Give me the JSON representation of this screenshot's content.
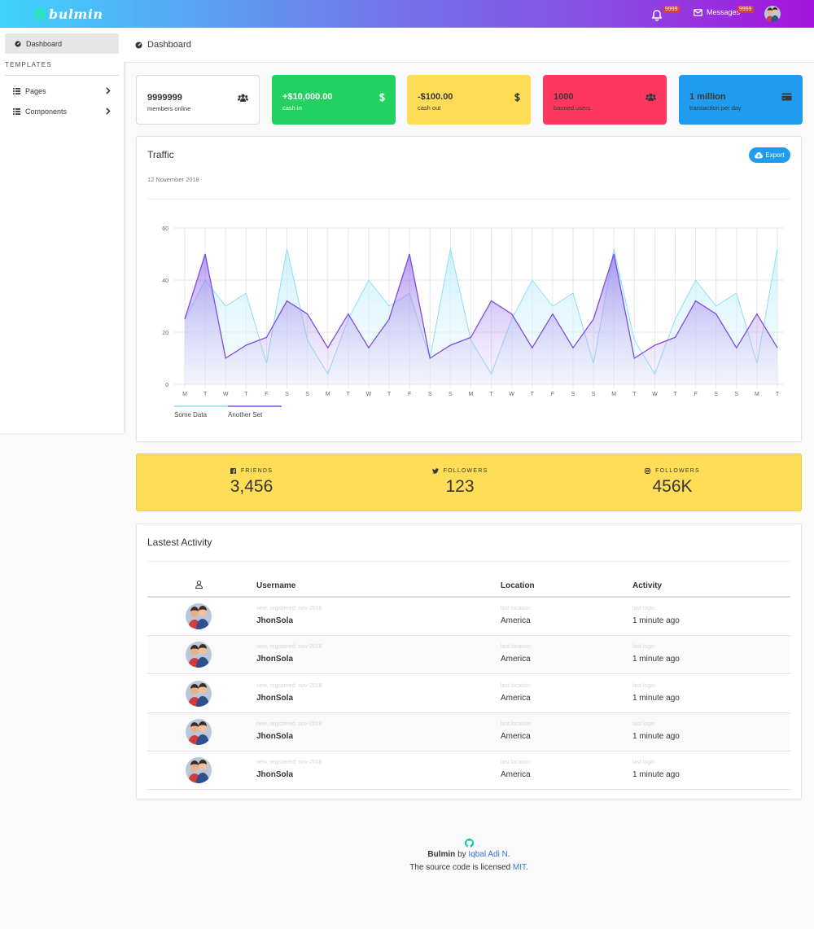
{
  "brand": {
    "name": "bulmin",
    "logo_color": "#2ee0c5"
  },
  "navbar": {
    "notifications_badge": "9999",
    "messages_label": "Messages",
    "messages_badge": "9999",
    "icons": [
      "bell-icon",
      "envelope-icon",
      "avatar"
    ]
  },
  "sidebar": {
    "active_item": "Dashboard",
    "section_label": "TEMPLATES",
    "items": [
      {
        "label": "Pages",
        "icon": "list-icon"
      },
      {
        "label": "Components",
        "icon": "list-icon"
      }
    ]
  },
  "page_header": {
    "title": "Dashboard"
  },
  "stats": [
    {
      "value": "9999999",
      "label": "members online",
      "icon": "users-icon",
      "color": "#ffffff"
    },
    {
      "value": "+$10,000.00",
      "label": "cash in",
      "icon": "dollar-icon",
      "color": "#23d160"
    },
    {
      "value": "-$100.00",
      "label": "cash out",
      "icon": "dollar-icon",
      "color": "#ffdd57"
    },
    {
      "value": "1000",
      "label": "banned users",
      "icon": "users-icon",
      "color": "#ff3860"
    },
    {
      "value": "1 million",
      "label": "transaction per day",
      "icon": "credit-card-icon",
      "color": "#209cee"
    }
  ],
  "traffic": {
    "title": "Traffic",
    "date": "12 November 2018",
    "export_label": "Export"
  },
  "chart_data": {
    "type": "area",
    "title": "",
    "xlabel": "",
    "ylabel": "",
    "categories": [
      "M",
      "T",
      "W",
      "T",
      "F",
      "S",
      "S",
      "M",
      "T",
      "W",
      "T",
      "F",
      "S",
      "S",
      "M",
      "T",
      "W",
      "T",
      "F",
      "S",
      "S",
      "M",
      "T",
      "W",
      "T",
      "F",
      "S",
      "S",
      "M",
      "T"
    ],
    "ylim": [
      0,
      60
    ],
    "yticks": [
      0,
      20,
      40,
      60
    ],
    "grid": true,
    "legend": "bottom-left",
    "series": [
      {
        "name": "Some Data",
        "color": "#5dd3f0",
        "values": [
          25,
          40,
          30,
          35,
          8,
          52,
          17,
          4,
          25,
          40,
          30,
          35,
          10,
          52,
          17,
          4,
          25,
          40,
          30,
          35,
          8,
          52,
          17,
          4,
          25,
          40,
          30,
          35,
          8,
          52
        ]
      },
      {
        "name": "Another Set",
        "color": "#7d4be3",
        "values": [
          25,
          50,
          10,
          15,
          18,
          32,
          27,
          14,
          27,
          14,
          25,
          50,
          10,
          15,
          18,
          32,
          27,
          14,
          27,
          14,
          25,
          50,
          10,
          15,
          18,
          32,
          27,
          14,
          27,
          14
        ]
      }
    ]
  },
  "social": [
    {
      "icon": "facebook-icon",
      "label": "FRIENDS",
      "value": "3,456"
    },
    {
      "icon": "twitter-icon",
      "label": "FOLLOWERS",
      "value": "123"
    },
    {
      "icon": "instagram-icon",
      "label": "FOLLOWERS",
      "value": "456K"
    }
  ],
  "activity": {
    "title": "Lastest Activity",
    "columns": [
      "Username",
      "Location",
      "Activity"
    ],
    "rows": [
      {
        "sub_user": "new, registered: nov-2018",
        "username": "JhonSola",
        "sub_loc": "last location",
        "location": "America",
        "sub_act": "last login",
        "activity": "1 minute ago"
      },
      {
        "sub_user": "new, registered: nov-2018",
        "username": "JhonSola",
        "sub_loc": "last location",
        "location": "America",
        "sub_act": "last login",
        "activity": "1 minute ago"
      },
      {
        "sub_user": "new, registered: nov-2018",
        "username": "JhonSola",
        "sub_loc": "last location",
        "location": "America",
        "sub_act": "last login",
        "activity": "1 minute ago"
      },
      {
        "sub_user": "new, registered: nov-2018",
        "username": "JhonSola",
        "sub_loc": "last location",
        "location": "America",
        "sub_act": "last login",
        "activity": "1 minute ago"
      },
      {
        "sub_user": "new, registered: nov-2018",
        "username": "JhonSola",
        "sub_loc": "last location",
        "location": "America",
        "sub_act": "last login",
        "activity": "1 minute ago"
      }
    ]
  },
  "footer": {
    "brand": "Bulmin",
    "by": " by ",
    "author": "Iqbal Adi N",
    "period": ".",
    "license_text": "The source code is licensed ",
    "license": "MIT",
    "period2": "."
  }
}
